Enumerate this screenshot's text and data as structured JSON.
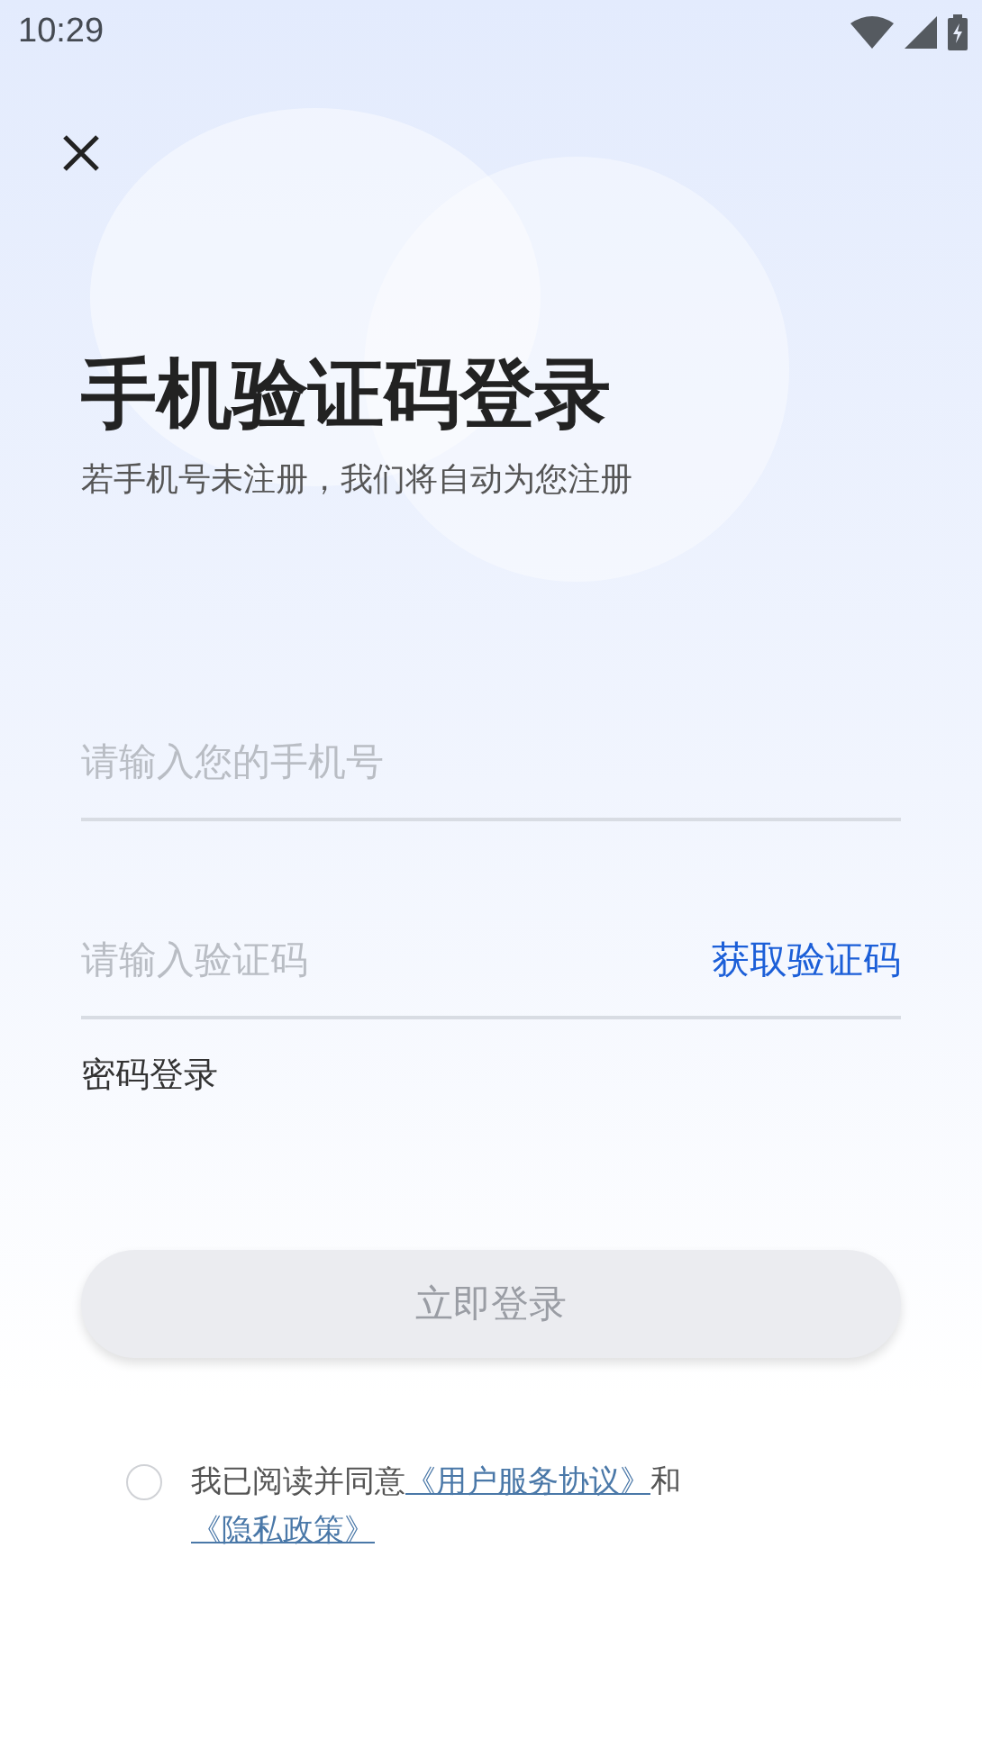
{
  "status_bar": {
    "time": "10:29"
  },
  "title": "手机验证码登录",
  "subtitle": "若手机号未注册，我们将自动为您注册",
  "phone_field": {
    "placeholder": "请输入您的手机号"
  },
  "code_field": {
    "placeholder": "请输入验证码",
    "action": "获取验证码"
  },
  "password_login_link": "密码登录",
  "login_button": {
    "label": "立即登录",
    "disabled": true
  },
  "agreement": {
    "checked": false,
    "text": "我已阅读并同意",
    "link_1": "《用户服务协议》",
    "conjunction": "和",
    "link_2": "《隐私政策》"
  }
}
